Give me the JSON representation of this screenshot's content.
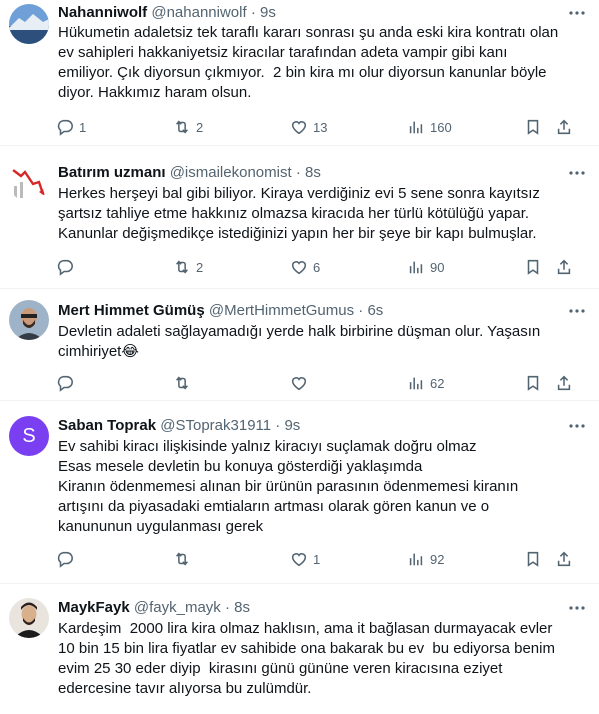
{
  "tweets": [
    {
      "name": "Nahanniwolf",
      "handle": "@nahanniwolf",
      "time": "9s",
      "text": "Hükumetin adaletsiz tek taraflı kararı sonrası şu anda eski kira kontratı olan\nev sahipleri hakkaniyetsiz kiracılar tarafından adeta vampir gibi kanı\nemiliyor. Çık diyorsun çıkmıyor.  2 bin kira mı olur diyorsun kanunlar böyle\ndiyor. Hakkımız haram olsun.",
      "replies": "1",
      "retweets": "2",
      "likes": "13",
      "views": "160"
    },
    {
      "name": "Batırım uzmanı",
      "handle": "@ismailekonomist",
      "time": "8s",
      "text": "Herkes herşeyi bal gibi biliyor. Kiraya verdiğiniz evi 5 sene sonra kayıtsız\nşartsız tahliye etme hakkınız olmazsa kiracıda her türlü kötülüğü yapar.\nKanunlar değişmedikçe istediğinizi yapın her bir şeye bir kapı bulmuşlar.",
      "replies": "",
      "retweets": "2",
      "likes": "6",
      "views": "90"
    },
    {
      "name": "Mert Himmet Gümüş",
      "handle": "@MertHimmetGumus",
      "time": "6s",
      "text": "Devletin adaleti sağlayamadığı yerde halk birbirine düşman olur. Yaşasın\ncimhiriyet😂",
      "replies": "",
      "retweets": "",
      "likes": "",
      "views": "62"
    },
    {
      "name": "Saban Toprak",
      "handle": "@SToprak31911",
      "time": "9s",
      "avatar_letter": "S",
      "text": "Ev sahibi kiracı ilişkisinde yalnız kiracıyı suçlamak doğru olmaz\nEsas mesele devletin bu konuya gösterdiği yaklaşımda\nKiranın ödenmemesi alınan bir ürünün parasının ödenmemesi kiranın\nartışını da piyasadaki emtiaların artması olarak gören kanun ve o\nkanununun uygulanması gerek",
      "replies": "",
      "retweets": "",
      "likes": "1",
      "views": "92"
    },
    {
      "name": "MaykFayk",
      "handle": "@fayk_mayk",
      "time": "8s",
      "text": "Kardeşim  2000 lira kira olmaz haklısın, ama it bağlasan durmayacak evler\n10 bin 15 bin lira fiyatlar ev sahibide ona bakarak bu ev  bu ediyorsa benim\nevim 25 30 eder diyip  kirasını günü gününe veren kiracısına eziyet\nedercesine tavır alıyorsa bu zulümdür."
    }
  ],
  "colors": {
    "secondary": "#536471",
    "primary": "#0f1419",
    "divider": "#eff3f4",
    "saban_avatar": "#7a3ff0"
  },
  "icons": [
    "reply-icon",
    "retweet-icon",
    "like-icon",
    "views-icon",
    "bookmark-icon",
    "share-icon",
    "more-icon"
  ]
}
